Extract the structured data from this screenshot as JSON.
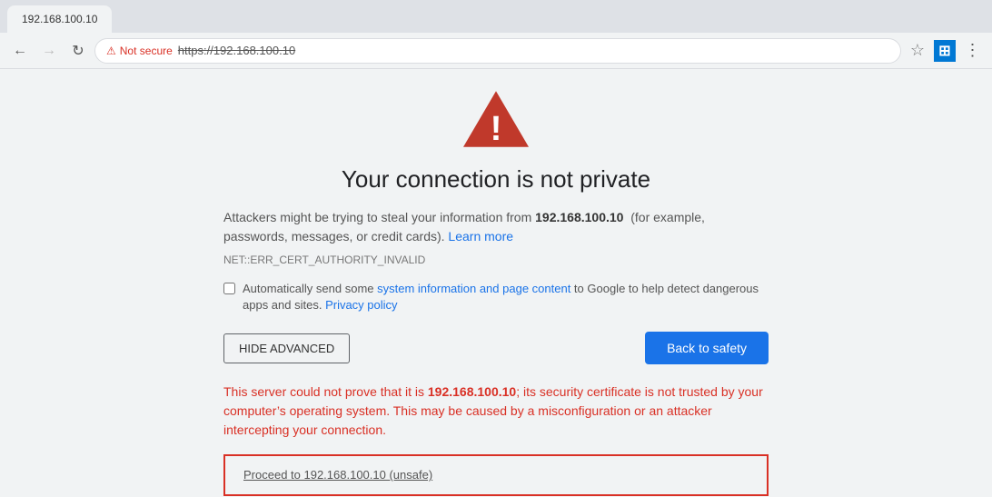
{
  "browser": {
    "tab_title": "192.168.100.10",
    "back_button_label": "←",
    "forward_button_label": "→",
    "reload_button_label": "↻",
    "security_label": "Not secure",
    "url": "https://192.168.100.10",
    "bookmark_icon": "☆",
    "win_icon_label": "⊞",
    "menu_icon": "⋮"
  },
  "page": {
    "heading": "Your connection is not private",
    "description_before_bold": "Attackers might be trying to steal your information from ",
    "bold_ip": "192.168.100.10",
    "description_after_bold": "  (for example, passwords, messages, or credit cards). ",
    "learn_more_link": "Learn more",
    "error_code": "NET::ERR_CERT_AUTHORITY_INVALID",
    "checkbox_text_before_link": "Automatically send some ",
    "checkbox_link_text": "system information and page content",
    "checkbox_text_after_link": " to Google to help detect dangerous apps and sites. ",
    "privacy_policy_link": "Privacy policy",
    "hide_advanced_label": "HIDE ADVANCED",
    "back_to_safety_label": "Back to safety",
    "advanced_text_before_bold": "This server could not prove that it is ",
    "advanced_bold": "192.168.100.10",
    "advanced_text_after": "; its security certificate is not trusted by your computer’s operating system. This may be caused by a misconfiguration or an attacker intercepting your connection.",
    "proceed_link_text": "Proceed to 192.168.100.10 (unsafe)"
  }
}
